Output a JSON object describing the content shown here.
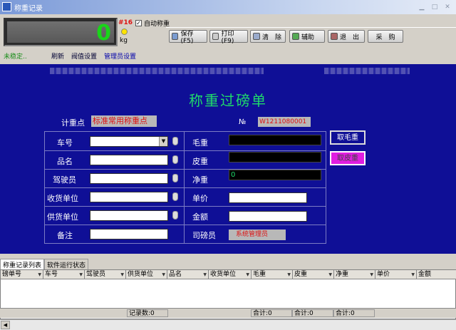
{
  "window": {
    "title": "称重记录"
  },
  "scale": {
    "reading": "0",
    "code": "#16",
    "unit": "kg",
    "status": "未稳定..",
    "links": [
      "刷新",
      "阀值设置",
      "管理员设置"
    ]
  },
  "auto_weigh": {
    "label": "自动称重",
    "checked": true
  },
  "toolbar": {
    "buttons": [
      "保存(F5)",
      "打印(F9)",
      "清　除",
      "辅助",
      "退　出",
      "采　购"
    ]
  },
  "form": {
    "title": "称重过磅单",
    "point_label": "计重点",
    "point_value": "标准常用称重点",
    "no_label": "№",
    "no_value": "W1211080001",
    "left_labels": [
      "车号",
      "品名",
      "驾驶员",
      "收货单位",
      "供货单位",
      "备注"
    ],
    "right_labels": [
      "毛重",
      "皮重",
      "净重",
      "单价",
      "金额",
      "司磅员"
    ],
    "net_weight": "0",
    "operator": "系统管理员",
    "get_gross_button": "取毛重",
    "get_tare_button": "取皮重"
  },
  "tabs": [
    "称重记录列表",
    "软件运行状态"
  ],
  "table": {
    "columns": [
      "磅单号",
      "车号",
      "驾驶员",
      "供货单位",
      "品名",
      "收货单位",
      "毛重",
      "皮重",
      "净重",
      "单价",
      "金额"
    ],
    "footer": {
      "count": "记录数:0",
      "sum1": "合计:0",
      "sum2": "合计:0",
      "sum3": "合计:0"
    }
  }
}
